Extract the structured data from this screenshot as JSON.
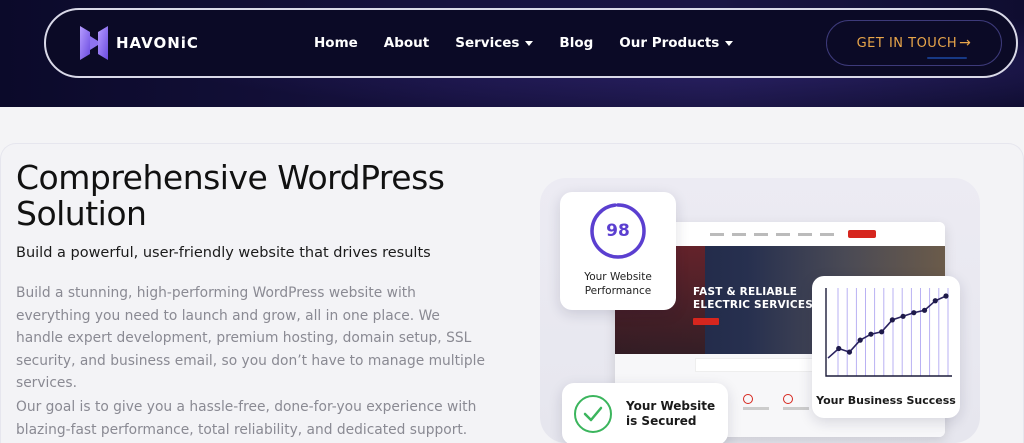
{
  "header": {
    "logo_text": "HAVONiC",
    "nav": [
      {
        "label": "Home",
        "has_dropdown": false
      },
      {
        "label": "About",
        "has_dropdown": false
      },
      {
        "label": "Services",
        "has_dropdown": true
      },
      {
        "label": "Blog",
        "has_dropdown": false
      },
      {
        "label": "Our Products",
        "has_dropdown": true
      }
    ],
    "cta_label": "GET IN TOUCH",
    "cta_arrow": "→"
  },
  "hero": {
    "title": "Comprehensive WordPress Solution",
    "subtitle": "Build a powerful, user-friendly website that drives results",
    "paragraph_1": "Build a stunning, high-performing WordPress website with everything you need to launch and grow, all in one place. We handle expert development, premium hosting, domain setup, SSL security, and business email, so you don’t have to manage multiple services.",
    "paragraph_2": "Our goal is to give you a hassle-free, done-for-you experience with blazing-fast performance, total reliability, and dedicated support."
  },
  "illustration": {
    "site_hero_text": "FAST & RELIABLE\nELECTRIC SERVICES",
    "performance_score": "98",
    "performance_label": "Your Website Performance",
    "secured_label": "Your Website is Secured",
    "business_label": "Your Business Success",
    "business_chart_values": [
      10,
      18,
      15,
      25,
      30,
      32,
      42,
      45,
      48,
      50,
      58,
      62
    ]
  },
  "colors": {
    "nav_bg": "#0b0a26",
    "cta_text": "#e9a64a",
    "accent_purple": "#5b3fd0",
    "check_green": "#3bb55d",
    "site_red": "#d6261e"
  }
}
